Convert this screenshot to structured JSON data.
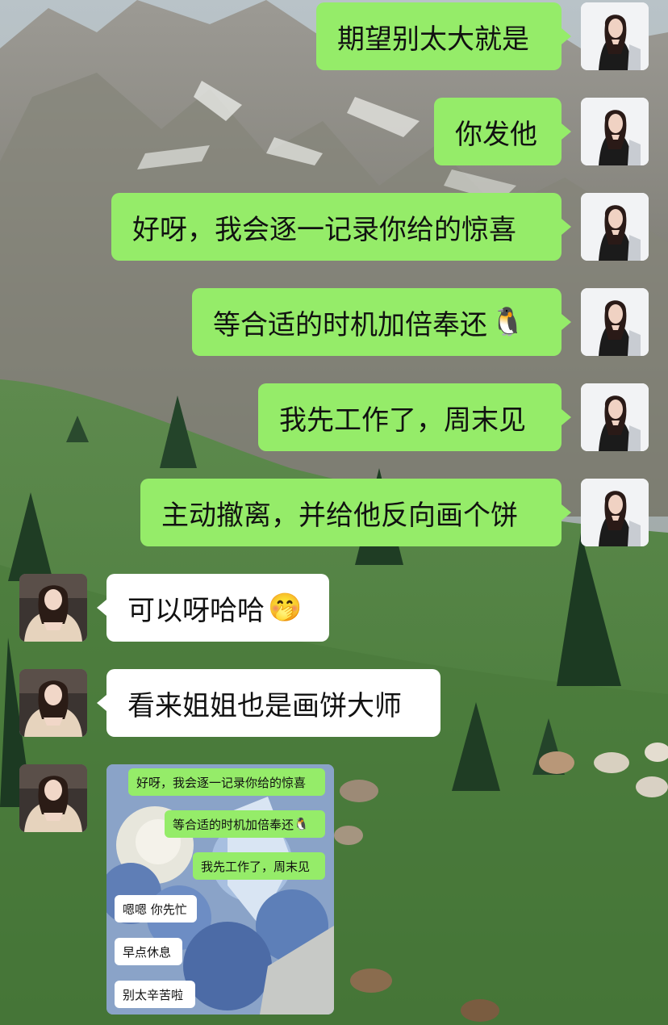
{
  "conversation": {
    "messages": [
      {
        "side": "right",
        "text": "期望别太大就是",
        "emoji": ""
      },
      {
        "side": "right",
        "text": "你发他",
        "emoji": ""
      },
      {
        "side": "right",
        "text": "好呀，我会逐一记录你给的惊喜",
        "emoji": ""
      },
      {
        "side": "right",
        "text": "等合适的时机加倍奉还",
        "emoji": "🐧"
      },
      {
        "side": "right",
        "text": "我先工作了，周末见",
        "emoji": ""
      },
      {
        "side": "right",
        "text": "主动撤离，并给他反向画个饼",
        "emoji": ""
      },
      {
        "side": "left",
        "text": "可以呀哈哈",
        "emoji": "🤭"
      },
      {
        "side": "left",
        "text": "看来姐姐也是画饼大师",
        "emoji": ""
      }
    ],
    "embedded_screenshot": {
      "messages": [
        {
          "side": "right",
          "text": "好呀，我会逐一记录你给的惊喜",
          "emoji": ""
        },
        {
          "side": "right",
          "text": "等合适的时机加倍奉还",
          "emoji": "🐧"
        },
        {
          "side": "right",
          "text": "我先工作了，周末见",
          "emoji": ""
        },
        {
          "side": "left",
          "text": "嗯嗯 你先忙",
          "emoji": ""
        },
        {
          "side": "left",
          "text": "早点休息",
          "emoji": ""
        },
        {
          "side": "left",
          "text": "别太辛苦啦",
          "emoji": ""
        }
      ]
    }
  },
  "colors": {
    "right_bubble": "#95ec69",
    "left_bubble": "#ffffff"
  }
}
